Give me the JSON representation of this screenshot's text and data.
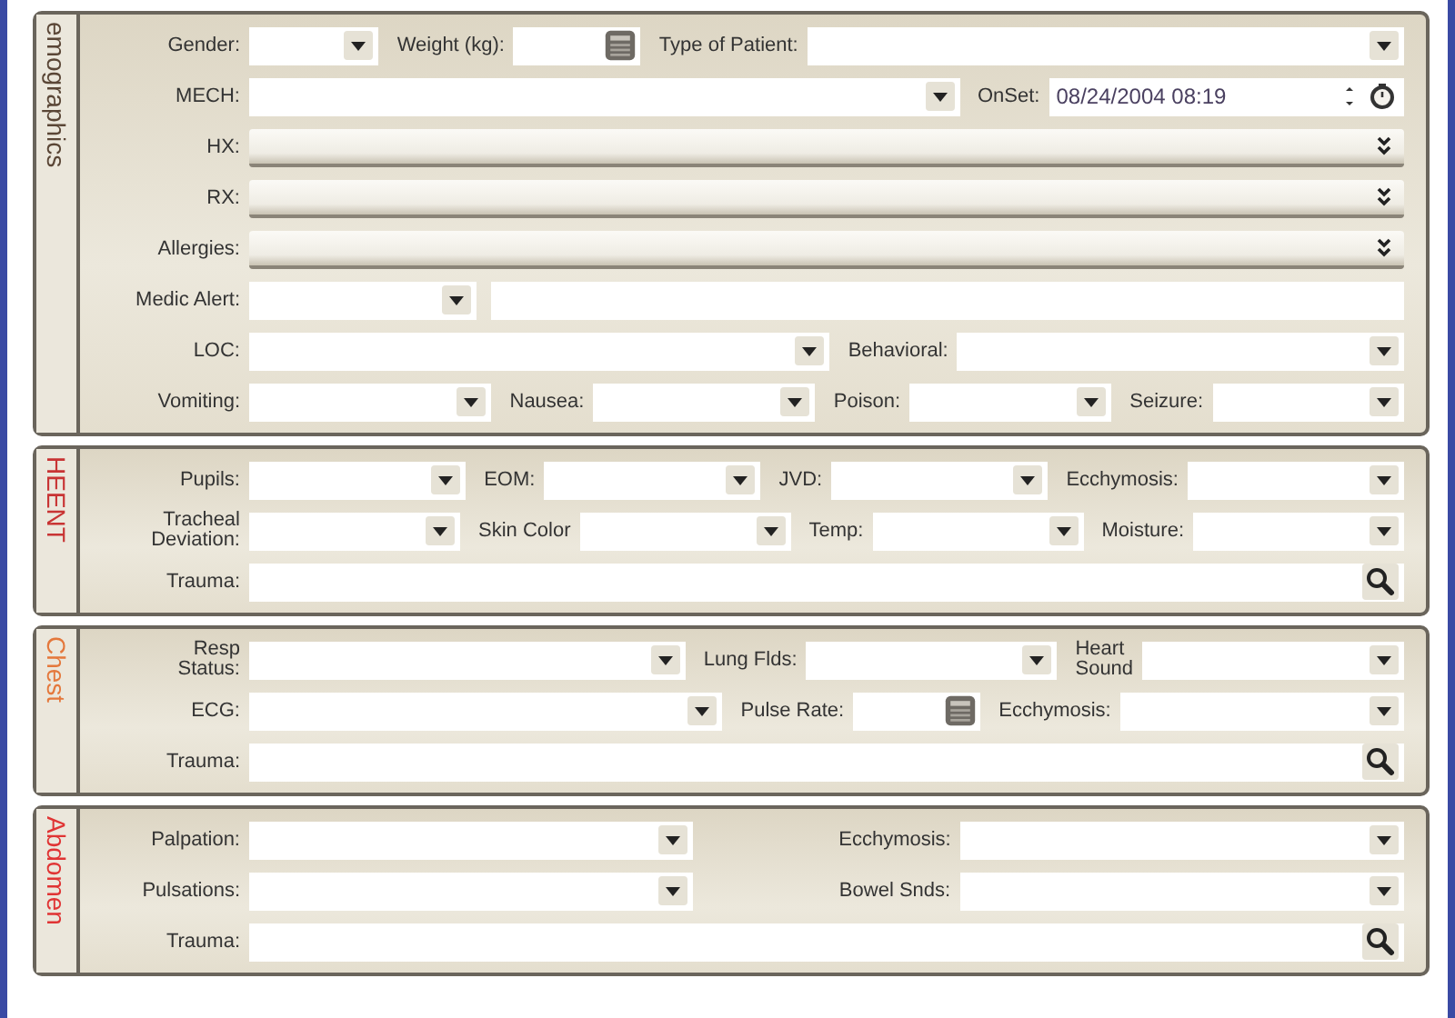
{
  "sections": [
    {
      "title": "emographics",
      "color": "#5a4636",
      "rows": [
        {
          "fields": [
            {
              "label": "Gender:",
              "kind": "combo"
            },
            {
              "label": "Weight (kg):",
              "kind": "spin"
            },
            {
              "label": "Type of Patient:",
              "kind": "combo"
            }
          ]
        },
        {
          "fields": [
            {
              "label": "MECH:",
              "kind": "combo"
            },
            {
              "label": "OnSet:",
              "kind": "datetime",
              "value": "08/24/2004 08:19"
            }
          ]
        },
        {
          "fields": [
            {
              "label": "HX:",
              "kind": "expander"
            }
          ]
        },
        {
          "fields": [
            {
              "label": "RX:",
              "kind": "expander"
            }
          ]
        },
        {
          "fields": [
            {
              "label": "Allergies:",
              "kind": "expander"
            }
          ]
        },
        {
          "fields": [
            {
              "label": "Medic Alert:",
              "kind": "combo"
            },
            {
              "kind": "text"
            }
          ]
        },
        {
          "fields": [
            {
              "label": "LOC:",
              "kind": "combo"
            },
            {
              "label": "Behavioral:",
              "kind": "combo"
            }
          ]
        },
        {
          "fields": [
            {
              "label": "Vomiting:",
              "kind": "combo"
            },
            {
              "label": "Nausea:",
              "kind": "combo"
            },
            {
              "label": "Poison:",
              "kind": "combo"
            },
            {
              "label": "Seizure:",
              "kind": "combo"
            }
          ]
        }
      ]
    },
    {
      "title": "HEENT",
      "color": "#c83434",
      "rows": [
        {
          "fields": [
            {
              "label": "Pupils:",
              "kind": "combo"
            },
            {
              "label": "EOM:",
              "kind": "combo"
            },
            {
              "label": "JVD:",
              "kind": "combo"
            },
            {
              "label": "Ecchymosis:",
              "kind": "combo"
            }
          ]
        },
        {
          "fields": [
            {
              "label": "Tracheal\nDeviation:",
              "kind": "combo"
            },
            {
              "label": "Skin Color",
              "kind": "combo"
            },
            {
              "label": "Temp:",
              "kind": "combo"
            },
            {
              "label": "Moisture:",
              "kind": "combo"
            }
          ]
        },
        {
          "fields": [
            {
              "label": "Trauma:",
              "kind": "search"
            }
          ]
        }
      ]
    },
    {
      "title": "Chest",
      "color": "#e4783c",
      "rows": [
        {
          "fields": [
            {
              "label": "Resp\nStatus:",
              "kind": "combo"
            },
            {
              "label": "Lung Flds:",
              "kind": "combo"
            },
            {
              "label": "Heart\nSound",
              "kind": "combo"
            }
          ]
        },
        {
          "fields": [
            {
              "label": "ECG:",
              "kind": "combo"
            },
            {
              "label": "Pulse Rate:",
              "kind": "spin"
            },
            {
              "label": "Ecchymosis:",
              "kind": "combo"
            }
          ]
        },
        {
          "fields": [
            {
              "label": "Trauma:",
              "kind": "search"
            }
          ]
        }
      ]
    },
    {
      "title": "Abdomen",
      "color": "#e03434",
      "rows": [
        {
          "fields": [
            {
              "label": "Palpation:",
              "kind": "combo"
            },
            {
              "label": "Ecchymosis:",
              "kind": "combo"
            }
          ]
        },
        {
          "fields": [
            {
              "label": "Pulsations:",
              "kind": "combo"
            },
            {
              "label": "Bowel Snds:",
              "kind": "combo"
            }
          ]
        },
        {
          "fields": [
            {
              "label": "Trauma:",
              "kind": "search"
            }
          ]
        }
      ]
    }
  ]
}
